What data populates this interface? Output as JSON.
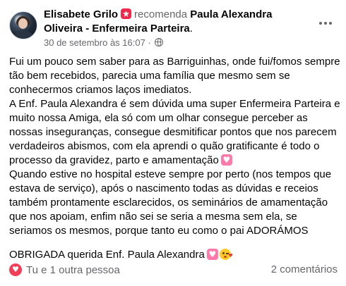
{
  "post": {
    "author": "Elisabete Grilo",
    "action": "recomenda",
    "recommended": "Paula Alexandra Oliveira - Enfermeira Parteira",
    "recommended_suffix": ".",
    "timestamp": "30 de setembro às 16:07",
    "meta_separator": "·",
    "icons": {
      "recommend": "recommend-star-icon",
      "privacy": "globe-icon",
      "more": "more-options-icon"
    },
    "body": {
      "p1": "Fui um pouco sem saber para as Barriguinhas, onde fui/fomos sempre tão bem recebidos, parecia uma família que mesmo sem se conhecermos criamos laços imediatos.",
      "p2": "A Enf. Paula Alexandra é sem dúvida uma super Enfermeira Parteira e muito nossa Amiga, ela só com um olhar consegue perceber as nossas inseguranças, consegue desmitificar pontos que nos parecem verdadeiros abismos, com ela aprendi o quão gratificante é todo o processo da gravidez, parto e amamentação",
      "p3": "Quando estive no hospital esteve sempre por perto (nos tempos que estava de serviço), após o nascimento todas as dúvidas e receios também prontamente esclarecidos, os seminários de amamentação que nos apoiam, enfim não sei se seria a mesma sem ela, se seriamos os mesmos, porque tanto eu como o pai ADORÁMOS",
      "p4": "OBRIGADA querida Enf. Paula Alexandra"
    },
    "emojis": {
      "heart": "heart-emoji",
      "kiss": "face-blowing-kiss-emoji"
    }
  },
  "footer": {
    "reaction_icon": "love-reaction-icon",
    "reactions_text": "Tu e 1 outra pessoa",
    "comments": "2 comentários"
  },
  "colors": {
    "text": "#050505",
    "secondary": "#65676b",
    "recommend_red": "#f02849",
    "love_reaction": "#f33e58"
  }
}
